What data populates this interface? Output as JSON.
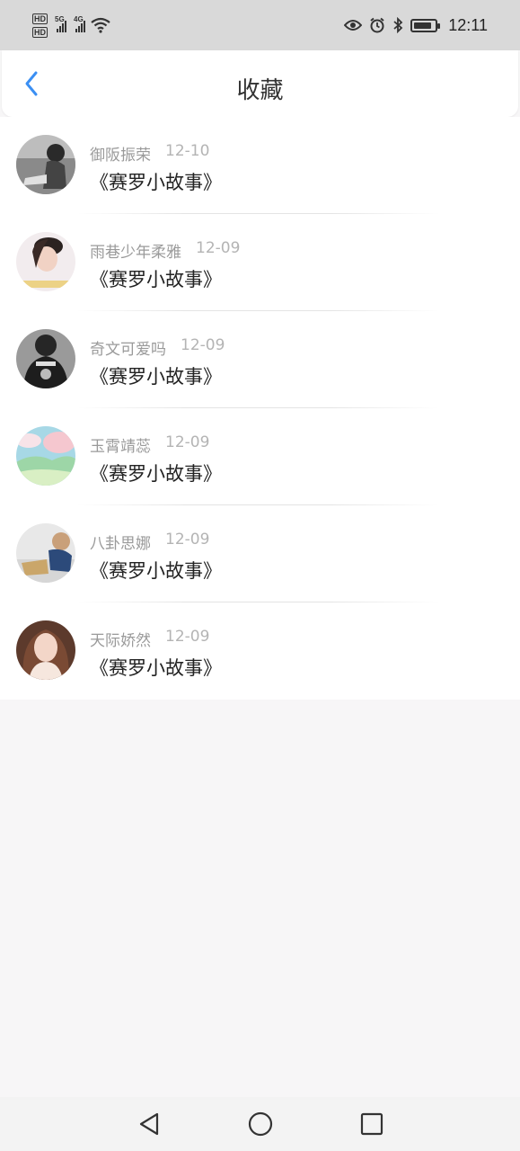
{
  "status_bar": {
    "left_badges": [
      "HD",
      "HD"
    ],
    "sim1_tag": "5G",
    "sim2_tag": "4G",
    "time": "12:11",
    "battery_level": 0.85,
    "icons": [
      "eye-icon",
      "alarm-icon",
      "bluetooth-icon",
      "battery-icon"
    ]
  },
  "header": {
    "title": "收藏",
    "back_icon": "chevron-left-icon",
    "accent_color": "#3b8ff3"
  },
  "items": [
    {
      "user": "御阪振荣",
      "date": "12-10",
      "title": "《赛罗小故事》"
    },
    {
      "user": "雨巷少年柔雅",
      "date": "12-09",
      "title": "《赛罗小故事》"
    },
    {
      "user": "奇文可爱吗",
      "date": "12-09",
      "title": "《赛罗小故事》"
    },
    {
      "user": "玉霄靖蕊",
      "date": "12-09",
      "title": "《赛罗小故事》"
    },
    {
      "user": "八卦思娜",
      "date": "12-09",
      "title": "《赛罗小故事》"
    },
    {
      "user": "天际娇然",
      "date": "12-09",
      "title": "《赛罗小故事》"
    }
  ],
  "nav_bar": {
    "icons": [
      "back-triangle-icon",
      "home-circle-icon",
      "recents-square-icon"
    ]
  }
}
